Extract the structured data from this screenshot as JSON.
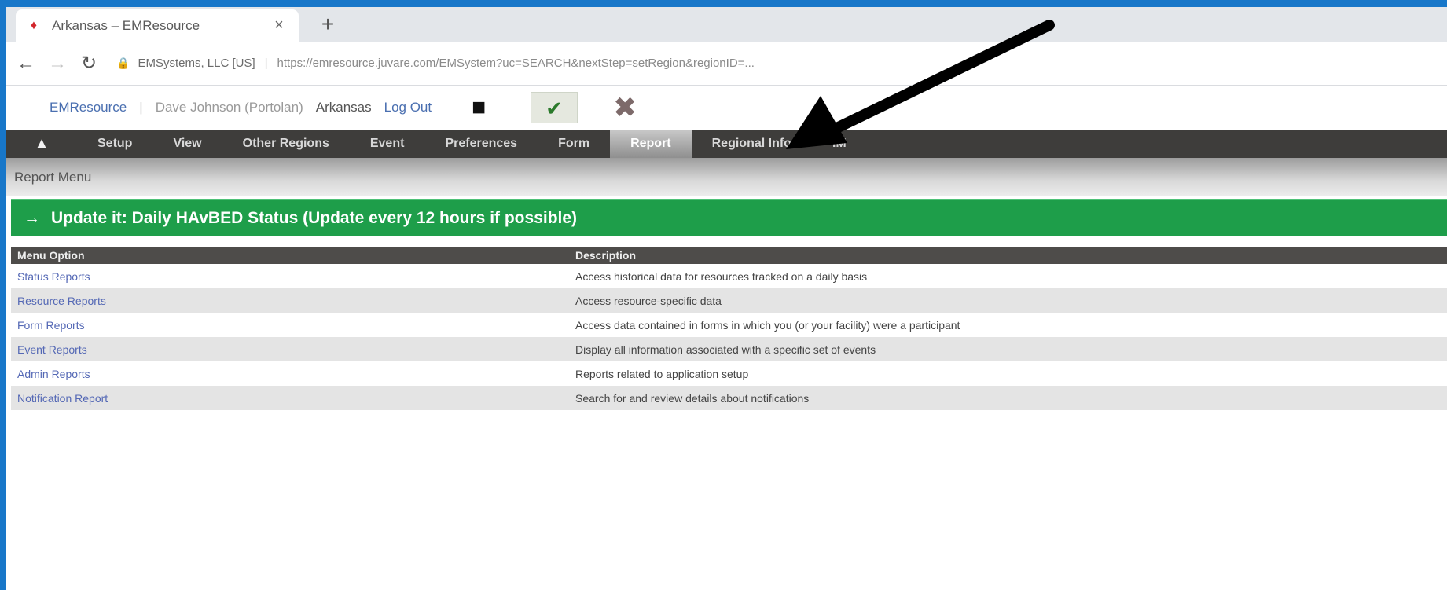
{
  "browser": {
    "tab_title": "Arkansas – EMResource",
    "tab_close": "×",
    "new_tab": "+",
    "back": "←",
    "forward": "→",
    "reload": "↻",
    "site_identity": "EMSystems, LLC [US]",
    "url": "https://emresource.juvare.com/EMSystem?uc=SEARCH&nextStep=setRegion&regionID=..."
  },
  "header": {
    "app_name": "EMResource",
    "separator": "|",
    "user_info": "Dave Johnson (Portolan)",
    "region": "Arkansas",
    "logout": "Log Out",
    "icons": [
      "key-icon",
      "checkmark-icon",
      "tools-icon"
    ]
  },
  "nav": {
    "home_icon": "home-icon",
    "items": [
      "Setup",
      "View",
      "Other Regions",
      "Event",
      "Preferences",
      "Form",
      "Report",
      "Regional Info",
      "IM"
    ],
    "active": "Report"
  },
  "submenu": {
    "title": "Report Menu"
  },
  "banner": {
    "arrow": "→",
    "text": "Update it: Daily HAvBED Status (Update every 12 hours if possible)",
    "color": "#1e9e4a"
  },
  "table": {
    "headers": [
      "Menu Option",
      "Description"
    ],
    "rows": [
      {
        "option": "Status Reports",
        "description": "Access historical data for resources tracked on a daily basis"
      },
      {
        "option": "Resource Reports",
        "description": "Access resource-specific data"
      },
      {
        "option": "Form Reports",
        "description": "Access data contained in forms in which you (or your facility) were a participant"
      },
      {
        "option": "Event Reports",
        "description": "Display all information associated with a specific set of events"
      },
      {
        "option": "Admin Reports",
        "description": "Reports related to application setup"
      },
      {
        "option": "Notification Report",
        "description": "Search for and review details about notifications"
      }
    ]
  },
  "colors": {
    "frame_border": "#1877c9",
    "nav_bg": "#3e3d3b",
    "link": "#5468b5"
  }
}
